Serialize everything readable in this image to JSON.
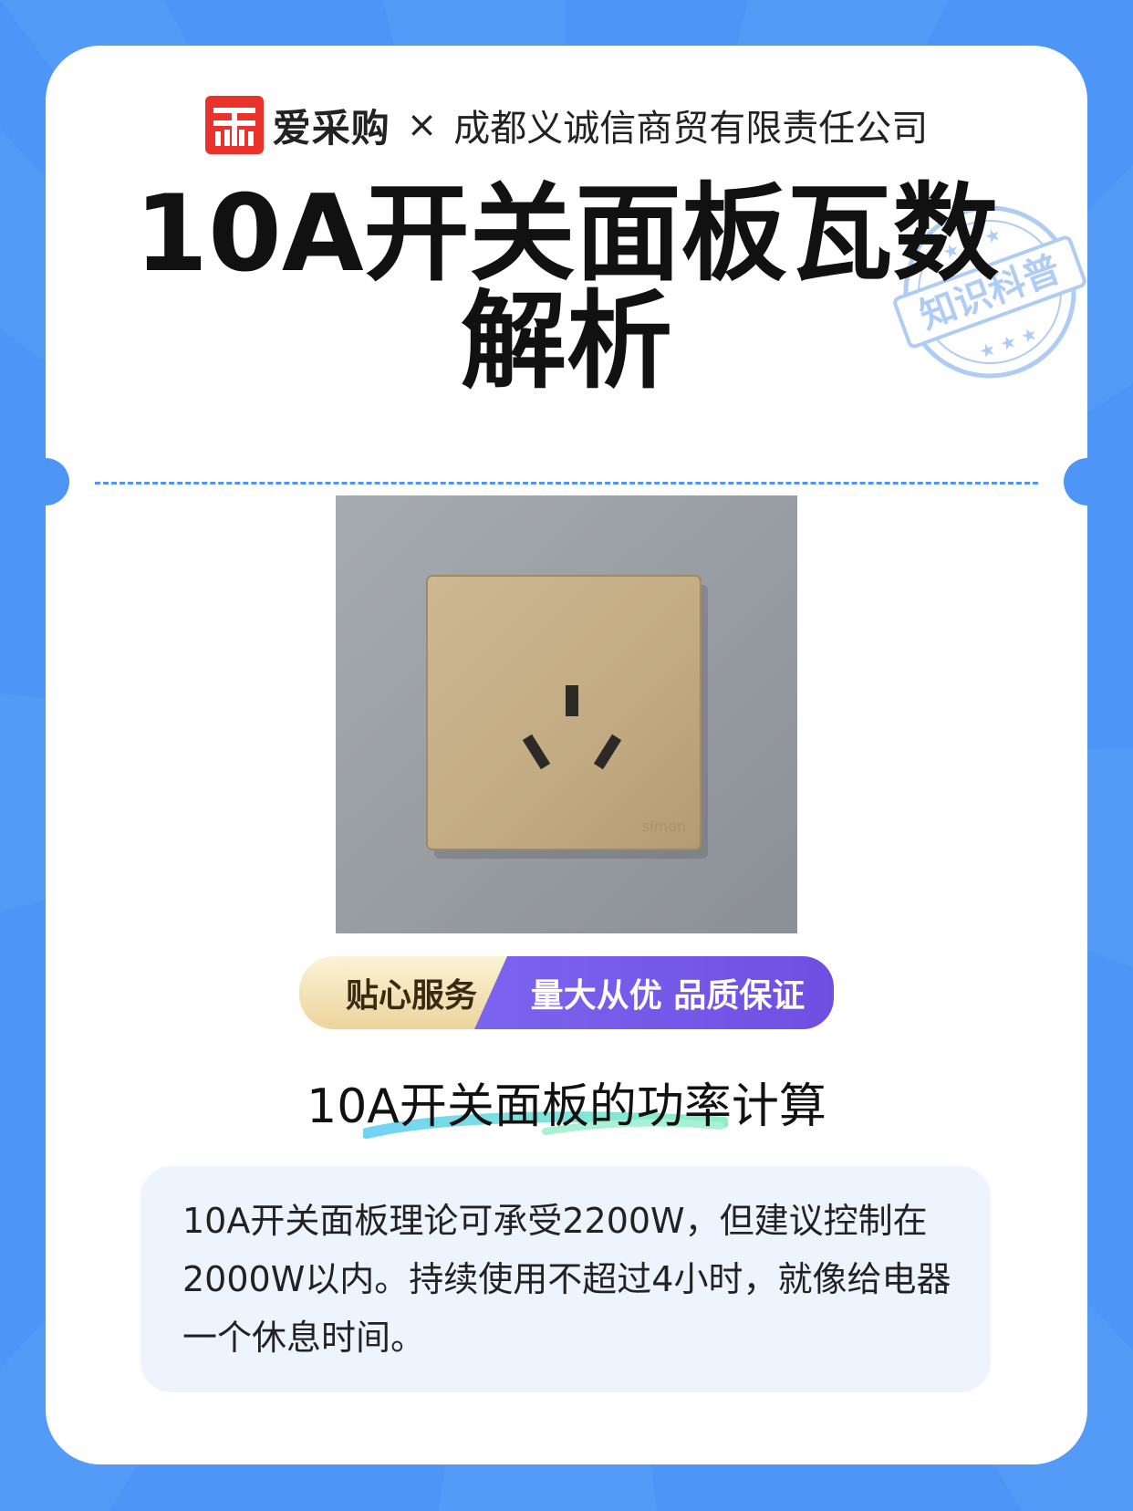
{
  "header": {
    "logo_glyph": "采",
    "brand": "爱采购",
    "times": "×",
    "company": "成都义诚信商贸有限责任公司"
  },
  "stamp": {
    "text": "知识科普"
  },
  "title": {
    "line1": "10A开关面板瓦数",
    "line2": "解析"
  },
  "photo": {
    "brand_mark": "simon"
  },
  "banner": {
    "left": "贴心服务",
    "right": "量大从优 品质保证"
  },
  "section": {
    "subtitle": "10A开关面板的功率计算",
    "body": "10A开关面板理论可承受2200W，但建议控制在2000W以内。持续使用不超过4小时，就像给电器一个休息时间。"
  },
  "colors": {
    "background": "#4d95f6",
    "card": "#ffffff",
    "accent_red": "#e8322b",
    "banner_gold": "#ecd49c",
    "banner_purple": "#7059e6",
    "info_bg": "#eef4fd"
  }
}
